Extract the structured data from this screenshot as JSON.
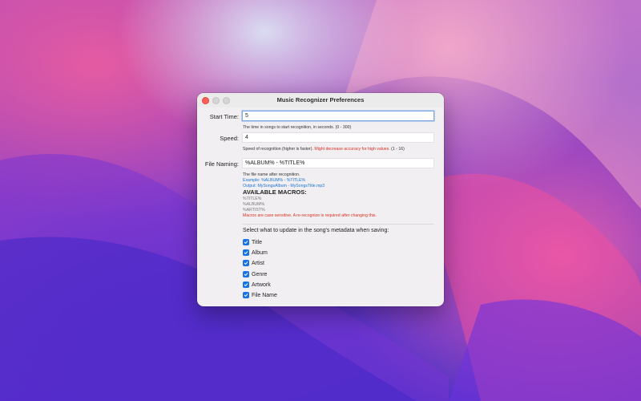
{
  "window": {
    "title": "Music Recognizer Preferences"
  },
  "start_time": {
    "label": "Start Time:",
    "value": "5",
    "hint": "The time in songs to start recognition, in seconds. (0 - 300)"
  },
  "speed": {
    "label": "Speed:",
    "value": "4",
    "hint_main": "Speed of recognition (higher is faster). ",
    "hint_warning": "Might decrease accuracy for high values.",
    "hint_range": " (1 - 16)"
  },
  "file_naming": {
    "label": "File Naming:",
    "value": "%ALBUM% - %TITLE%",
    "hint": "The file name after recognition.",
    "example": "Example: %ALBUM% - %TITLE%",
    "output": "Output: MySongsAlbum - MySongsTitle.mp3",
    "macros_title": "AVAILABLE MACROS:",
    "macros": [
      "%TITLE%",
      "%ALBUM%",
      "%ARTIST%"
    ],
    "macros_warning": "Macros are case sensitive. A re-recognize is required after changing this."
  },
  "metadata": {
    "prompt": "Select what to update in the song's metadata when saving:",
    "options": [
      {
        "label": "Title",
        "checked": true
      },
      {
        "label": "Album",
        "checked": true
      },
      {
        "label": "Artist",
        "checked": true
      },
      {
        "label": "Genre",
        "checked": true
      },
      {
        "label": "Artwork",
        "checked": true
      },
      {
        "label": "File Name",
        "checked": true
      }
    ]
  },
  "colors": {
    "accent": "#1673e6",
    "warning": "#d93025",
    "link_blue": "#1a73d8",
    "close_button": "#ff5f57"
  }
}
